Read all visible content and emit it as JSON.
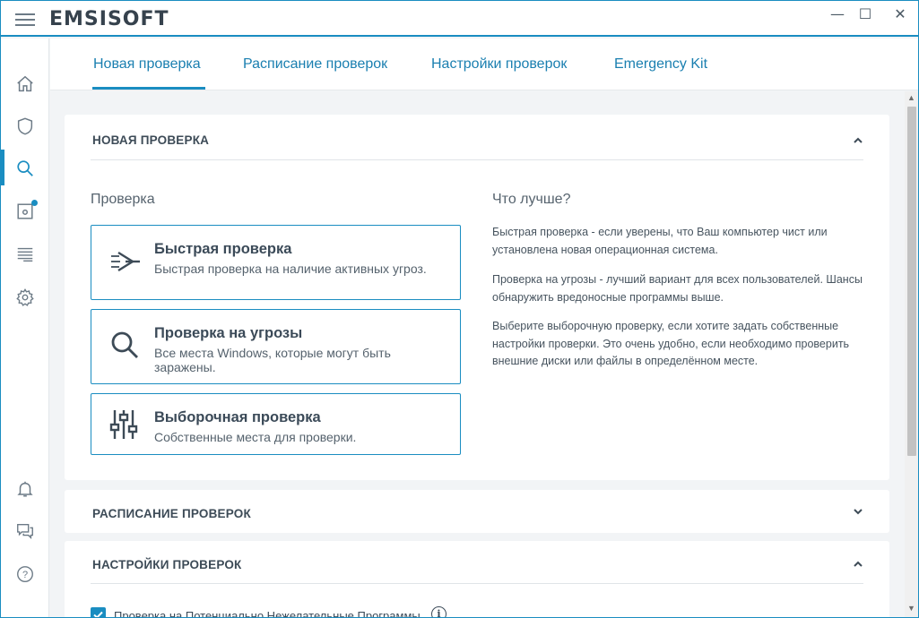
{
  "app": {
    "logo": "EMSISOFT",
    "window_controls": {
      "minimize": "—",
      "maximize": "☐",
      "close": "✕"
    }
  },
  "sidebar": {
    "items": [
      {
        "icon": "home-icon"
      },
      {
        "icon": "shield-icon"
      },
      {
        "icon": "search-icon",
        "active": true
      },
      {
        "icon": "quarantine-icon",
        "badge": true
      },
      {
        "icon": "logs-icon"
      },
      {
        "icon": "gear-icon"
      }
    ],
    "bottom_items": [
      {
        "icon": "bell-icon"
      },
      {
        "icon": "chat-icon"
      },
      {
        "icon": "help-icon",
        "text": "?"
      }
    ]
  },
  "tabs": [
    {
      "label": "Новая проверка",
      "active": true
    },
    {
      "label": "Расписание проверок"
    },
    {
      "label": "Настройки проверок"
    },
    {
      "label": "Emergency Kit"
    }
  ],
  "new_scan": {
    "title": "НОВАЯ ПРОВЕРКА",
    "section_label": "Проверка",
    "cards": [
      {
        "icon": "quick-scan-icon",
        "title": "Быстрая проверка",
        "desc": "Быстрая проверка на наличие активных угроз."
      },
      {
        "icon": "magnifier-icon",
        "title": "Проверка на угрозы",
        "desc": "Все места Windows, которые могут быть заражены."
      },
      {
        "icon": "sliders-icon",
        "title": "Выборочная проверка",
        "desc": "Собственные места для проверки."
      }
    ],
    "help_title": "Что лучше?",
    "help_paragraphs": [
      "Быстрая проверка - если уверены, что Ваш компьютер чист или установлена новая операционная система.",
      "Проверка на угрозы - лучший вариант для всех пользователей. Шансы обнаружить вредоносные программы выше.",
      "Выберите выборочную проверку, если хотите задать собственные настройки проверки. Это очень удобно, если необходимо проверить внешние диски или файлы в определённом месте."
    ]
  },
  "schedule": {
    "title": "РАСПИСАНИЕ ПРОВЕРОК"
  },
  "settings": {
    "title": "НАСТРОЙКИ ПРОВЕРОК",
    "options": [
      {
        "label": "Проверка на Потенциально Нежелательные Программы",
        "checked": true,
        "info": "i"
      }
    ]
  },
  "colors": {
    "accent": "#1a8dc1",
    "text": "#3b4a58"
  }
}
